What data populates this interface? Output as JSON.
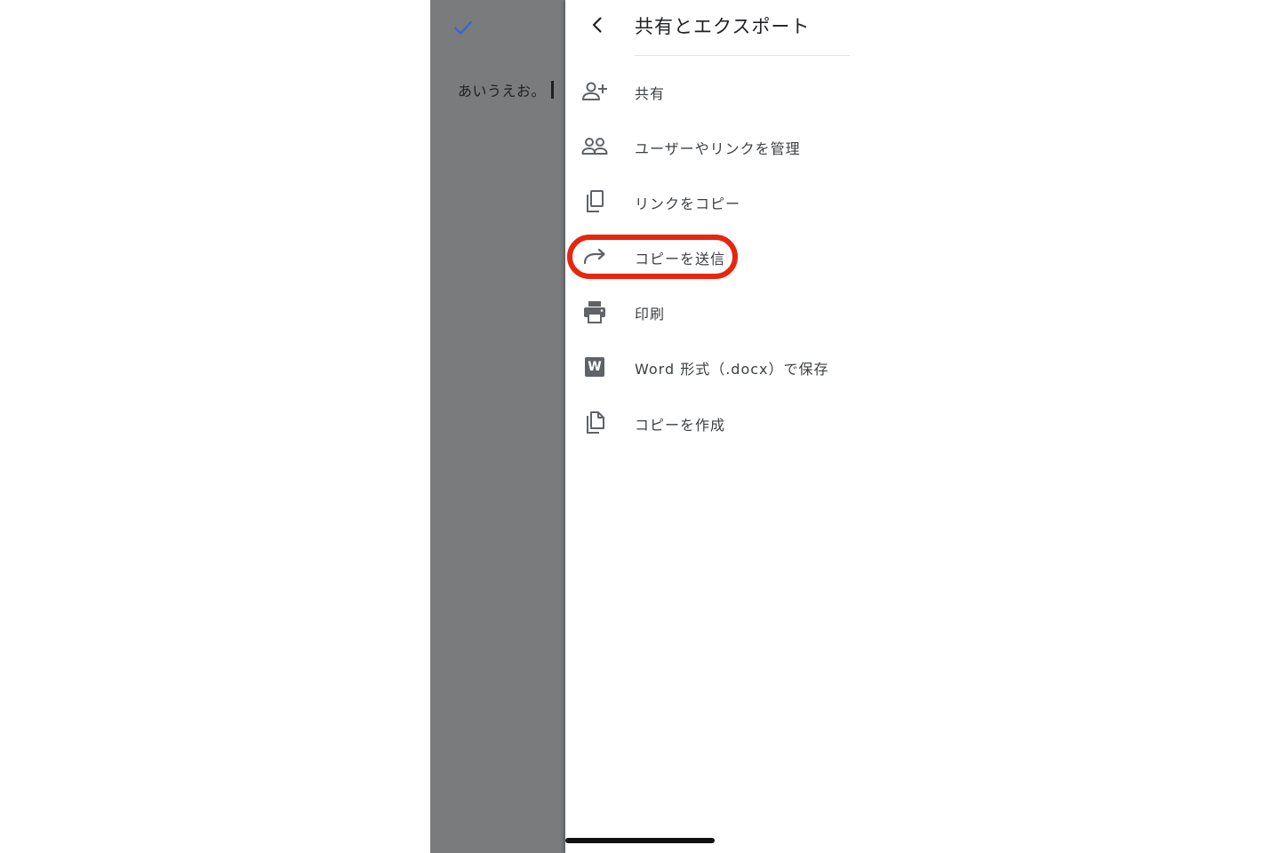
{
  "document": {
    "text": "あいうえお。"
  },
  "panel": {
    "title": "共有とエクスポート",
    "items": [
      {
        "label": "共有",
        "icon": "person-add-icon"
      },
      {
        "label": "ユーザーやリンクを管理",
        "icon": "people-icon"
      },
      {
        "label": "リンクをコピー",
        "icon": "copy-icon"
      },
      {
        "label": "コピーを送信",
        "icon": "share-arrow-icon"
      },
      {
        "label": "印刷",
        "icon": "printer-icon"
      },
      {
        "label": "Word 形式（.docx）で保存",
        "icon": "word-icon",
        "badge": "W"
      },
      {
        "label": "コピーを作成",
        "icon": "file-copy-icon"
      }
    ]
  },
  "colors": {
    "accent": "#3367d6",
    "overlay": "#7a7b7d",
    "highlight": "#e8250d",
    "icon": "#5f6368"
  }
}
